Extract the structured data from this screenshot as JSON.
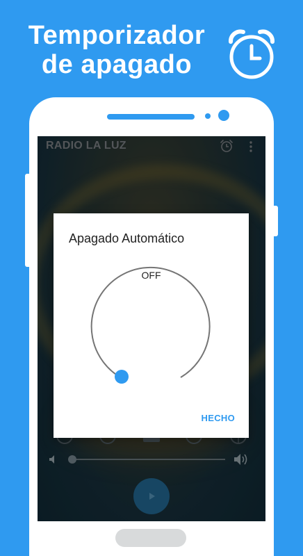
{
  "promo": {
    "headline_line1": "Temporizador",
    "headline_line2": "de apagado",
    "icon": "alarm-clock-icon"
  },
  "app": {
    "title": "RADIO LA LUZ",
    "actions": [
      "alarm-clock-icon",
      "more-vert-icon"
    ]
  },
  "dialog": {
    "title": "Apagado Automático",
    "timer_value": "OFF",
    "done_label": "HECHO"
  },
  "player": {
    "volume_fraction": 0.0,
    "icons": [
      "volume-low-icon",
      "volume-high-icon",
      "play-icon"
    ]
  },
  "colors": {
    "accent": "#2f9af0",
    "background": "#2f9af0",
    "dial_track": "#757575"
  }
}
